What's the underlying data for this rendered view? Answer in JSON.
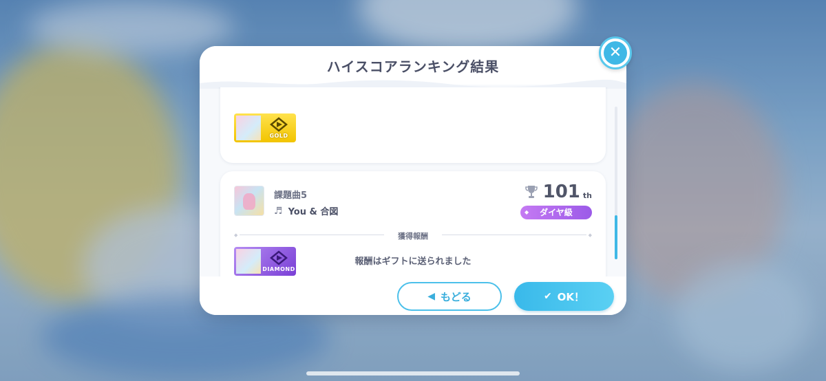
{
  "dialog": {
    "title": "ハイスコアランキング結果",
    "close_icon": "close-icon"
  },
  "top_card": {
    "reward": {
      "badge_text": "GOLD",
      "color": "#f2c400"
    }
  },
  "result_card": {
    "song_label": "課題曲5",
    "song_name": "You & 合図",
    "rank_number": "101",
    "rank_suffix": "th",
    "tier": "ダイヤ級",
    "rewards_divider": "獲得報酬",
    "reward": {
      "badge_text": "DIAMOND",
      "color": "#7a3fd6"
    }
  },
  "notice": "報酬はギフトに送られました",
  "buttons": {
    "back_label": "もどる",
    "ok_label": "OK！"
  },
  "colors": {
    "accent": "#3fb8e6",
    "tier_purple": "#9b5ae8",
    "text_dark": "#4a4f66"
  }
}
